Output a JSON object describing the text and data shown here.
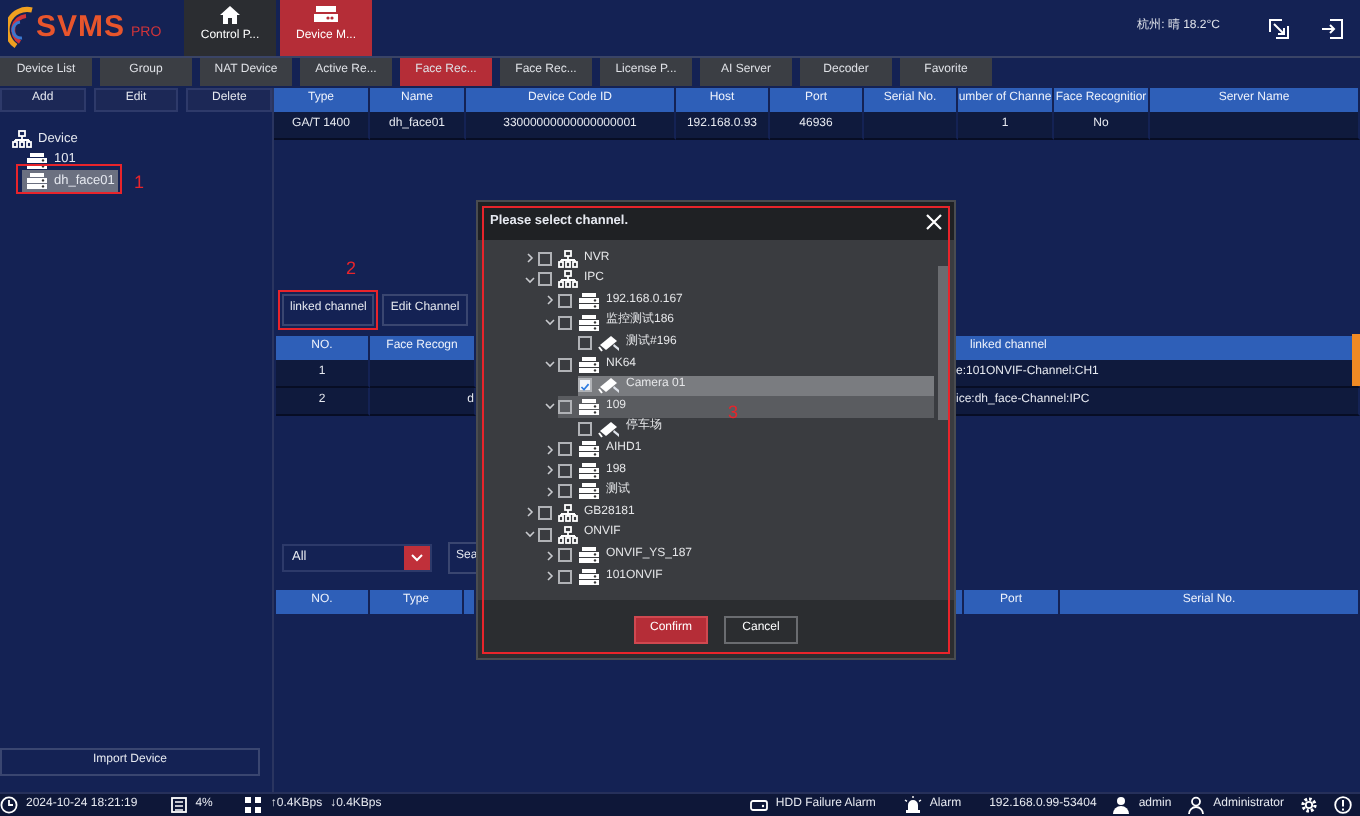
{
  "header": {
    "logo": {
      "name": "SVMS",
      "tag": "PRO"
    },
    "tabs": [
      {
        "label": "Control P...",
        "kind": "home",
        "selected": false
      },
      {
        "label": "Device M...",
        "kind": "devices",
        "selected": true
      }
    ],
    "weather": "杭州: 晴 18.2°C"
  },
  "subtabs": [
    {
      "label": "Device List",
      "selected": false
    },
    {
      "label": "Group",
      "selected": false
    },
    {
      "label": "NAT Device",
      "selected": false
    },
    {
      "label": "Active Re...",
      "selected": false
    },
    {
      "label": "Face Rec...",
      "selected": true
    },
    {
      "label": "Face Rec...",
      "selected": false
    },
    {
      "label": "License P...",
      "selected": false
    },
    {
      "label": "AI Server",
      "selected": false
    },
    {
      "label": "Decoder",
      "selected": false
    },
    {
      "label": "Favorite",
      "selected": false
    }
  ],
  "sidebar": {
    "buttons": [
      "Add",
      "Edit",
      "Delete"
    ],
    "tree": [
      {
        "label": "Device",
        "kind": "root",
        "selected": false,
        "children": [
          {
            "label": "101",
            "kind": "device",
            "selected": false
          },
          {
            "label": "dh_face01",
            "kind": "device",
            "selected": true,
            "annotation": "1"
          }
        ]
      }
    ],
    "import_button": "Import Device"
  },
  "device_table": {
    "columns": [
      "Type",
      "Name",
      "Device Code ID",
      "Host",
      "Port",
      "Serial No.",
      "umber of Channe",
      "Face Recognitior",
      "Server Name"
    ],
    "rows": [
      [
        "GA/T 1400",
        "dh_face01",
        "33000000000000000001",
        "192.168.0.93",
        "46936",
        null,
        "1",
        "No",
        null
      ]
    ]
  },
  "channel_section": {
    "buttons": [
      {
        "label": "linked channel",
        "annotation": "2"
      },
      {
        "label": "Edit Channel"
      }
    ],
    "columns": [
      "NO.",
      "Face Recogn",
      "linked channel"
    ],
    "rows": [
      [
        "1",
        null,
        "e:101ONVIF-Channel:CH1"
      ],
      [
        "2",
        "d",
        "ice:dh_face-Channel:IPC"
      ]
    ]
  },
  "filter": {
    "value": "All",
    "search_button": "Sea"
  },
  "lower_table": {
    "columns_left": [
      "NO.",
      "Type"
    ],
    "columns_right": [
      "Port",
      "Serial No."
    ]
  },
  "dialog": {
    "title": "Please select channel.",
    "annotation": "3",
    "tree": [
      {
        "label": "NVR",
        "kind": "group",
        "expanded": false,
        "checked": false,
        "selected": false,
        "hovered": false
      },
      {
        "label": "IPC",
        "kind": "group",
        "expanded": true,
        "checked": false,
        "selected": false,
        "hovered": false,
        "children": [
          {
            "label": "192.168.0.167",
            "kind": "device",
            "expanded": false,
            "checked": false,
            "selected": false,
            "hovered": false
          },
          {
            "label": "监控测试186",
            "kind": "device",
            "expanded": true,
            "checked": false,
            "selected": false,
            "hovered": false,
            "children": [
              {
                "label": "测试#196",
                "kind": "camera",
                "checked": false,
                "selected": false,
                "hovered": false
              }
            ]
          },
          {
            "label": "NK64",
            "kind": "device",
            "expanded": true,
            "checked": false,
            "selected": false,
            "hovered": false,
            "children": [
              {
                "label": "Camera 01",
                "kind": "camera",
                "checked": true,
                "selected": true,
                "hovered": false
              }
            ]
          },
          {
            "label": "109",
            "kind": "device",
            "expanded": true,
            "checked": false,
            "selected": false,
            "hovered": true,
            "children": [
              {
                "label": "停车场",
                "kind": "camera",
                "checked": false,
                "selected": false,
                "hovered": false
              }
            ]
          },
          {
            "label": "AIHD1",
            "kind": "device",
            "expanded": false,
            "checked": false,
            "selected": false,
            "hovered": false
          },
          {
            "label": "198",
            "kind": "device",
            "expanded": false,
            "checked": false,
            "selected": false,
            "hovered": false
          },
          {
            "label": "测试",
            "kind": "device",
            "expanded": false,
            "checked": false,
            "selected": false,
            "hovered": false
          }
        ]
      },
      {
        "label": "GB28181",
        "kind": "group",
        "expanded": false,
        "checked": false,
        "selected": false,
        "hovered": false
      },
      {
        "label": "ONVIF",
        "kind": "group",
        "expanded": true,
        "checked": false,
        "selected": false,
        "hovered": false,
        "children": [
          {
            "label": "ONVIF_YS_187",
            "kind": "device",
            "expanded": false,
            "checked": false,
            "selected": false,
            "hovered": false
          },
          {
            "label": "101ONVIF",
            "kind": "device",
            "expanded": false,
            "checked": false,
            "selected": false,
            "hovered": false
          }
        ]
      }
    ],
    "buttons": [
      {
        "label": "Confirm",
        "kind": "primary"
      },
      {
        "label": "Cancel",
        "kind": "secondary"
      }
    ]
  },
  "status_bar": {
    "datetime": "2024-10-24 18:21:19",
    "memory": "4%",
    "upload": "↑0.4KBps",
    "download": "↓0.4KBps",
    "hdd_alarm": "HDD Failure Alarm",
    "alarm": "Alarm",
    "address": "192.168.0.99-53404",
    "user": "admin",
    "role": "Administrator"
  }
}
